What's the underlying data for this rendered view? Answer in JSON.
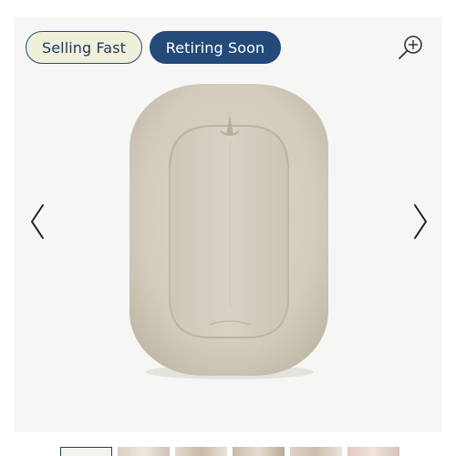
{
  "badges": {
    "selling_fast": "Selling Fast",
    "retiring_soon": "Retiring Soon"
  },
  "icons": {
    "zoom": "zoom-in-icon",
    "prev": "chevron-left-icon",
    "next": "chevron-right-icon"
  },
  "colors": {
    "badge_selling_bg": "#eef0da",
    "badge_retiring_bg": "#244a7a",
    "badge_text_dark": "#22395c",
    "product_fill": "#d9d1c3"
  },
  "gallery": {
    "thumbnail_count": 6,
    "active_thumbnail": 1
  }
}
